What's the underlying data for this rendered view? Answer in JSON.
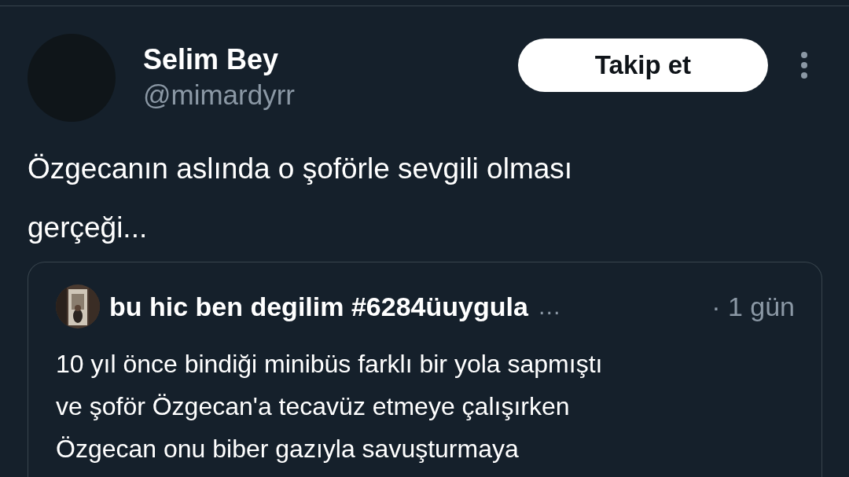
{
  "tweet": {
    "author": {
      "name": "Selim Bey",
      "handle": "@mimardyrr"
    },
    "follow_button": "Takip et",
    "text_lines": [
      "Özgecanın aslında o şoförle sevgili olması",
      "gerçeği..."
    ],
    "quoted_tweet": {
      "author": {
        "name": "bu hic ben degilim #6284üuygula",
        "truncation": "…"
      },
      "time": "· 1 gün",
      "text_lines": [
        "10 yıl önce bindiği minibüs farklı bir yola sapmıştı",
        "ve şoför Özgecan'a tecavüz etmeye çalışırken",
        "Özgecan onu biber gazıyla savuşturmaya"
      ]
    }
  }
}
